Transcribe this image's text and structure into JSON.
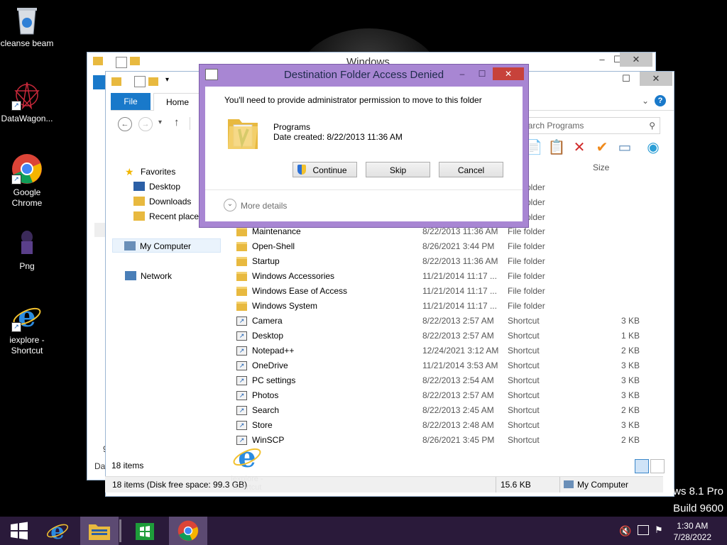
{
  "desktop": {
    "icons": [
      {
        "label": "cleanse beam"
      },
      {
        "label": "DataWagon..."
      },
      {
        "label": "Google Chrome"
      },
      {
        "label": "Png"
      },
      {
        "label": "iexplore - Shortcut"
      }
    ],
    "dragging_icon": {
      "label": "iexplore - Shortcut"
    },
    "watermark": {
      "line1": "ows 8.1 Pro",
      "line2": "Build 9600"
    }
  },
  "back_window": {
    "title": "Windows"
  },
  "explorer": {
    "tabs": {
      "file": "File",
      "home": "Home"
    },
    "search_placeholder": "earch Programs",
    "column_size": "Size",
    "nav": {
      "favorites": "Favorites",
      "desktop": "Desktop",
      "downloads": "Downloads",
      "recent": "Recent places",
      "computer": "My Computer",
      "network": "Network"
    },
    "partial_rows": [
      "older",
      "older",
      "older"
    ],
    "files": [
      {
        "name": "Maintenance",
        "date": "8/22/2013 11:36 AM",
        "type": "File folder",
        "size": "",
        "icon": "folder"
      },
      {
        "name": "Open-Shell",
        "date": "8/26/2021 3:44 PM",
        "type": "File folder",
        "size": "",
        "icon": "folder"
      },
      {
        "name": "Startup",
        "date": "8/22/2013 11:36 AM",
        "type": "File folder",
        "size": "",
        "icon": "folder"
      },
      {
        "name": "Windows Accessories",
        "date": "11/21/2014 11:17 ...",
        "type": "File folder",
        "size": "",
        "icon": "folder"
      },
      {
        "name": "Windows Ease of Access",
        "date": "11/21/2014 11:17 ...",
        "type": "File folder",
        "size": "",
        "icon": "folder"
      },
      {
        "name": "Windows System",
        "date": "11/21/2014 11:17 ...",
        "type": "File folder",
        "size": "",
        "icon": "folder"
      },
      {
        "name": "Camera",
        "date": "8/22/2013 2:57 AM",
        "type": "Shortcut",
        "size": "3 KB",
        "icon": "shortcut"
      },
      {
        "name": "Desktop",
        "date": "8/22/2013 2:57 AM",
        "type": "Shortcut",
        "size": "1 KB",
        "icon": "shortcut"
      },
      {
        "name": "Notepad++",
        "date": "12/24/2021 3:12 AM",
        "type": "Shortcut",
        "size": "2 KB",
        "icon": "shortcut"
      },
      {
        "name": "OneDrive",
        "date": "11/21/2014 3:53 AM",
        "type": "Shortcut",
        "size": "3 KB",
        "icon": "shortcut"
      },
      {
        "name": "PC settings",
        "date": "8/22/2013 2:54 AM",
        "type": "Shortcut",
        "size": "3 KB",
        "icon": "shortcut"
      },
      {
        "name": "Photos",
        "date": "8/22/2013 2:57 AM",
        "type": "Shortcut",
        "size": "3 KB",
        "icon": "shortcut"
      },
      {
        "name": "Search",
        "date": "8/22/2013 2:45 AM",
        "type": "Shortcut",
        "size": "2 KB",
        "icon": "shortcut"
      },
      {
        "name": "Store",
        "date": "8/22/2013 2:48 AM",
        "type": "Shortcut",
        "size": "3 KB",
        "icon": "shortcut"
      },
      {
        "name": "WinSCP",
        "date": "8/26/2021 3:45 PM",
        "type": "Shortcut",
        "size": "2 KB",
        "icon": "shortcut"
      }
    ],
    "status_items": "18 items",
    "back_status_partial": "Dat",
    "back_left_partial": "9"
  },
  "details_bar": {
    "items_free": "18 items (Disk free space: 99.3 GB)",
    "size": "15.6 KB",
    "location": "My Computer"
  },
  "dialog": {
    "title": "Destination Folder Access Denied",
    "message": "You'll need to provide administrator permission to move to this folder",
    "folder_name": "Programs",
    "date_created": "Date created: 8/22/2013 11:36 AM",
    "buttons": {
      "continue": "Continue",
      "skip": "Skip",
      "cancel": "Cancel"
    },
    "more_details": "More details"
  },
  "taskbar": {
    "time": "1:30 AM",
    "date": "7/28/2022"
  }
}
